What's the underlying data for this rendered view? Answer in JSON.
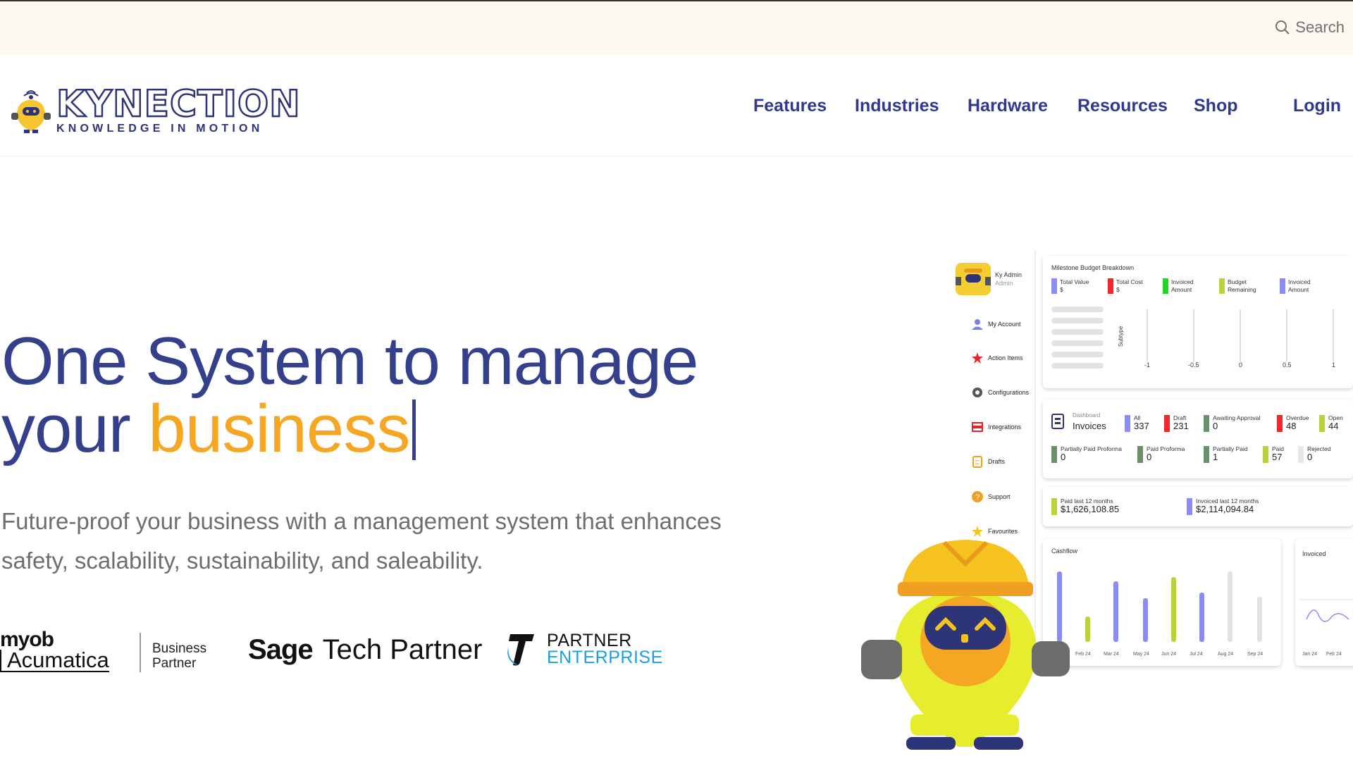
{
  "topbar": {
    "search_label": "Search",
    "search_icon": "search-icon"
  },
  "logo": {
    "name": "KYNECTION",
    "tagline": "KNOWLEDGE IN MOTION"
  },
  "nav": {
    "items": [
      "Features",
      "Industries",
      "Hardware",
      "Resources",
      "Shop"
    ],
    "login": "Login"
  },
  "hero": {
    "title_line1": "One System to manage",
    "title_line2_prefix": "your ",
    "title_line2_accent": "business",
    "subtitle_line1": "Future-proof your business with a management system that enhances",
    "subtitle_line2": "safety, scalability, sustainability, and saleability."
  },
  "partners": {
    "myob_top": "myob",
    "myob_bottom": "Acumatica",
    "myob_badge_1": "Business",
    "myob_badge_2": "Partner",
    "sage_word": "Sage",
    "sage_tail": "Tech Partner",
    "telstra_1": "PARTNER",
    "telstra_2": "ENTERPRISE"
  },
  "colors": {
    "brand": "#2d3478",
    "accent": "#f5a623",
    "topbar_bg": "#fdf9f0"
  },
  "dashboard": {
    "user": {
      "name": "Ky Admin",
      "role": "Admin"
    },
    "sidebar": [
      {
        "label": "My Account",
        "icon": "user-icon"
      },
      {
        "label": "Action Items",
        "icon": "star-icon"
      },
      {
        "label": "Configurations",
        "icon": "gear-icon"
      },
      {
        "label": "Integrations",
        "icon": "integrations-icon"
      },
      {
        "label": "Drafts",
        "icon": "clipboard-icon"
      },
      {
        "label": "Support",
        "icon": "help-icon"
      },
      {
        "label": "Favourites",
        "icon": "star-icon"
      }
    ],
    "milestone": {
      "title": "Milestone Budget Breakdown",
      "legend": [
        {
          "l1": "Total Value",
          "l2": "$",
          "color": "#8c8cf0"
        },
        {
          "l1": "Total Cost",
          "l2": "$",
          "color": "#f0282c"
        },
        {
          "l1": "Invoiced",
          "l2": "Amount",
          "color": "#22d626"
        },
        {
          "l1": "Budget",
          "l2": "Remaining",
          "color": "#b8d43a"
        },
        {
          "l1": "Invoiced",
          "l2": "Amount",
          "color": "#8c8cf0"
        }
      ],
      "axis_label": "Subtype",
      "ticks": [
        "-1",
        "-0.5",
        "0",
        "0.5",
        "1"
      ]
    },
    "invoices": {
      "overline": "Dashboard",
      "title": "Invoices",
      "row1": [
        {
          "label": "All",
          "value": "337",
          "color": "#8c8cf0"
        },
        {
          "label": "Draft",
          "value": "231",
          "color": "#f0282c"
        },
        {
          "label": "Awaiting Approval",
          "value": "0",
          "color": "#6b8f6b"
        },
        {
          "label": "Overdue",
          "value": "48",
          "color": "#f0282c"
        },
        {
          "label": "Open",
          "value": "44",
          "color": "#b8d43a"
        }
      ],
      "row2": [
        {
          "label": "Partially Paid Proforma",
          "value": "0",
          "color": "#6b8f6b"
        },
        {
          "label": "Paid Proforma",
          "value": "0",
          "color": "#6b8f6b"
        },
        {
          "label": "Partially Paid",
          "value": "1",
          "color": "#6b8f6b"
        },
        {
          "label": "Paid",
          "value": "57",
          "color": "#b8d43a"
        },
        {
          "label": "Rejected",
          "value": "0",
          "color": "#e8e8e8"
        }
      ]
    },
    "paid": {
      "paid_label": "Paid last 12 months",
      "paid_value": "$1,626,108.85",
      "invoiced_label": "Invoiced last 12 months",
      "invoiced_value": "$2,114,094.84"
    },
    "cashflow": {
      "title": "Cashflow",
      "months": [
        "Feb 24",
        "Mar 24",
        "May 24",
        "Jun 24",
        "Jul 24",
        "Aug 24",
        "Sep 24"
      ]
    },
    "invoiced_card": {
      "title": "Invoiced",
      "months": [
        "Jan 24",
        "Feb 24"
      ]
    }
  }
}
